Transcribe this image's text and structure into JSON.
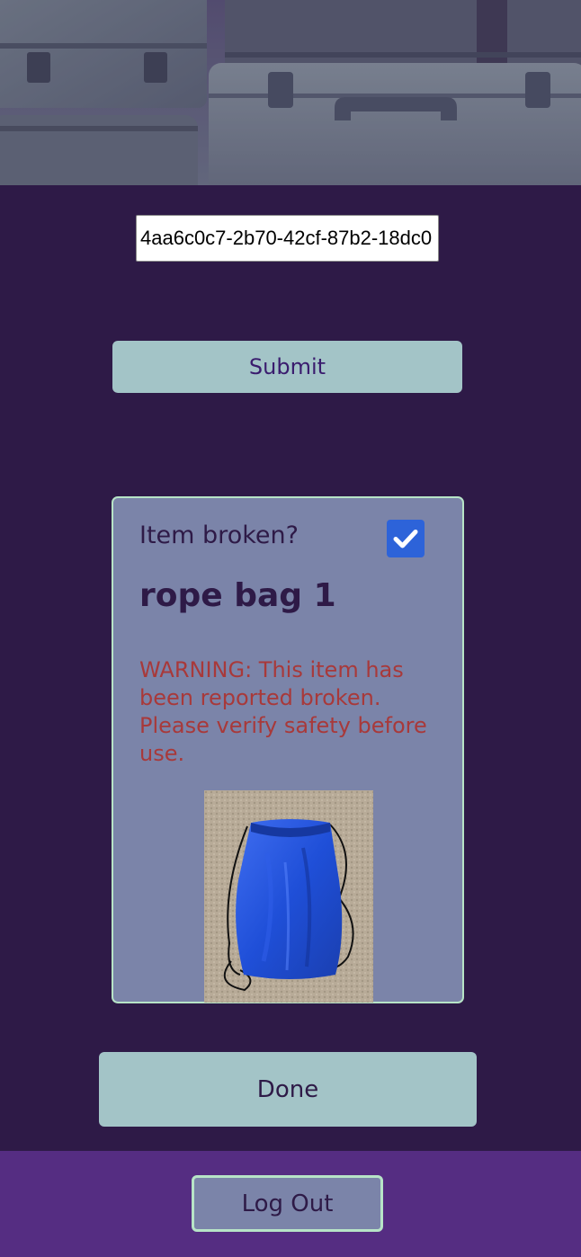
{
  "hero": {
    "image_name": "suitcases-banner"
  },
  "lookup": {
    "input_value": "4aa6c0c7-2b70-42cf-87b2-18dc0",
    "submit_label": "Submit"
  },
  "item_card": {
    "broken_label": "Item broken?",
    "broken_checked": true,
    "name": "rope bag 1",
    "warning": "WARNING: This item has been reported broken. Please verify safety before use.",
    "photo_name": "blue-drawstring-bag-photo"
  },
  "actions": {
    "done_label": "Done"
  },
  "footer": {
    "logout_label": "Log Out"
  },
  "colors": {
    "background": "#2e1a47",
    "button": "#a3c4c7",
    "card": "#7b84a9",
    "card_border": "#b7e4c7",
    "warning_text": "#a8393a",
    "footer": "#552d82",
    "checkbox": "#2d63d9"
  }
}
